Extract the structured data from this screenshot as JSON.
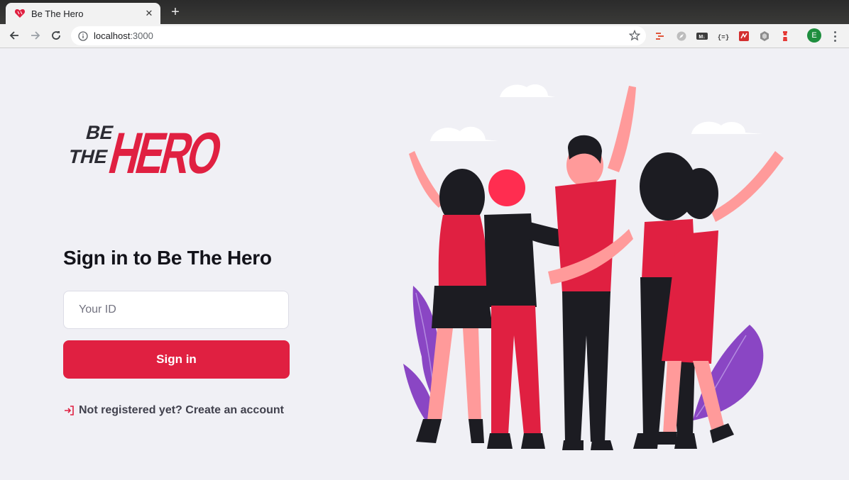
{
  "browser": {
    "tab_title": "Be The Hero",
    "close_label": "✕",
    "new_tab_label": "+",
    "url_host": "localhost",
    "url_port": ":3000",
    "profile_initial": "E",
    "extensions": [
      "json-ext",
      "compass-ext",
      "markdown-ext",
      "braces-ext",
      "red-ext",
      "cube-ext",
      "lighthouse-ext"
    ]
  },
  "login": {
    "logo_line1": "BE",
    "logo_line2": "THE",
    "logo_hero": "HERO",
    "heading": "Sign in to Be The Hero",
    "id_placeholder": "Your ID",
    "id_value": "",
    "signin_label": "Sign in",
    "register_label": "Not registered yet? Create an account"
  },
  "colors": {
    "brand": "#e02041",
    "background": "#f0f0f5",
    "text_dark": "#13131a",
    "text_link": "#41414d",
    "illustration_purple": "#8a46c4"
  }
}
